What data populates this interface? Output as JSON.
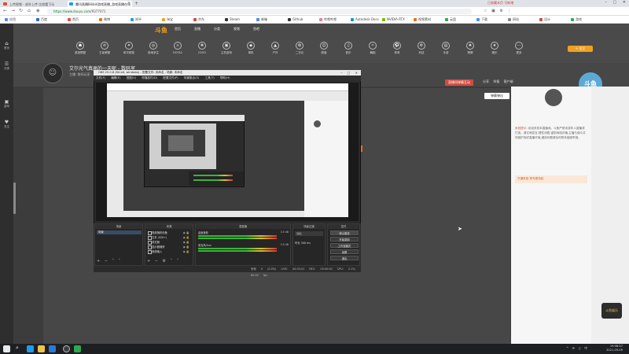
{
  "browser": {
    "tabs": [
      {
        "title": "上传视频 - 虎扑上传 比较看下乐"
      },
      {
        "title": "腾讯直播Bilibili游戏直播_游戏直播在线"
      }
    ],
    "window_controls": "– ▢ ✕",
    "toolbar_extra": "已收藏本页 可新增",
    "url_domain": "https://www.douyu.com",
    "url_rest": "/9377071",
    "right_tools": "☆ ▣ ⚙ ⋮",
    "bookmarks": [
      "应用",
      "百度",
      "首页",
      "微博",
      "知乎",
      "淘宝",
      "京东",
      "Steam",
      "邮箱",
      "Github",
      "哔哩哔哩",
      "Autodesk Docs",
      "NVIDIA RTX",
      "视频素材",
      "云盘",
      "下载",
      "网站",
      "设计",
      "游戏"
    ]
  },
  "leftbar": {
    "items": [
      {
        "icon": "⌂",
        "label": "首页"
      },
      {
        "icon": "☰",
        "label": "分类"
      },
      {
        "icon": "▣",
        "label": "游戏"
      },
      {
        "icon": "♥",
        "label": "关注"
      }
    ]
  },
  "site": {
    "logo": "斗鱼",
    "nav": [
      "首页",
      "直播",
      "分类",
      "视频",
      "鱼吧"
    ],
    "categories": [
      "英雄联盟",
      "王者荣耀",
      "和平精英",
      "绝地求生",
      "DOTA2",
      "CSGO",
      "主机游戏",
      "单机",
      "户外",
      "二次元",
      "颜值",
      "音乐",
      "舞蹈",
      "体育",
      "科技",
      "手游",
      "棋牌",
      "娱乐",
      "更多"
    ],
    "follow_label": "+ 关注"
  },
  "room": {
    "title": "艾尔光气真高的一天呢 - 数码室",
    "subtitle": "主播: 数码玩家 · 直播分类 数码科技",
    "action_button": "直播间弹幕互动",
    "links": [
      "分享",
      "举报",
      "客户端"
    ],
    "popup_button": "弹幕弹出",
    "mascot": "斗鱼"
  },
  "chat": {
    "notice_label": "系统提示:",
    "notice": "欢迎来到本直播间。斗鱼严禁未成年人直播或打赏。请文明发言,理性消费,谨防网络诈骗,主播与观众共同维护良好直播环境,遇到问题请及时联系客服举报。",
    "gift_text": "开通贵族 享专属特权",
    "mascot_bottom": "斗鱼娱乐"
  },
  "obs": {
    "title": "OBS 25.0.8 (64-bit, windows) - 配置文件: 未命名 - 场景: 未命名",
    "menu": [
      "文件(F)",
      "编辑(E)",
      "视图(V)",
      "停靠部件(D)",
      "配置文件(P)",
      "场景集合(S)",
      "工具(T)",
      "帮助(H)"
    ],
    "docks": {
      "scenes": {
        "header": "场景",
        "items": [
          "场景"
        ]
      },
      "sources": {
        "header": "来源",
        "items": [
          "视频捕获设备",
          "文本 (GDI+)",
          "浏览器",
          "显示器捕获",
          "音频输入"
        ]
      },
      "mixer": {
        "header": "混音器",
        "rows": [
          {
            "name": "桌面音频",
            "db": "0.0 dB"
          },
          {
            "name": "麦克风/Aux",
            "db": "0.0 dB"
          }
        ]
      },
      "transitions": {
        "header": "场景过渡",
        "selected": "淡出",
        "duration_label": "时长",
        "duration": "300 ms"
      },
      "controls": {
        "header": "控件",
        "buttons": [
          "停止推流",
          "开始录制",
          "工作室模式",
          "设置",
          "退出"
        ]
      }
    },
    "status": [
      "丢帧 0 (0.0%)",
      "LIVE: 00:03:41",
      "REC: 00:00:00",
      "CPU: 2.1%, 60.00 fps"
    ]
  },
  "taskbar": {
    "search_glyph": "⌕",
    "tray": "^ ✉ ♫ 中",
    "time": "19:08:57",
    "date": "2021-09-09"
  }
}
